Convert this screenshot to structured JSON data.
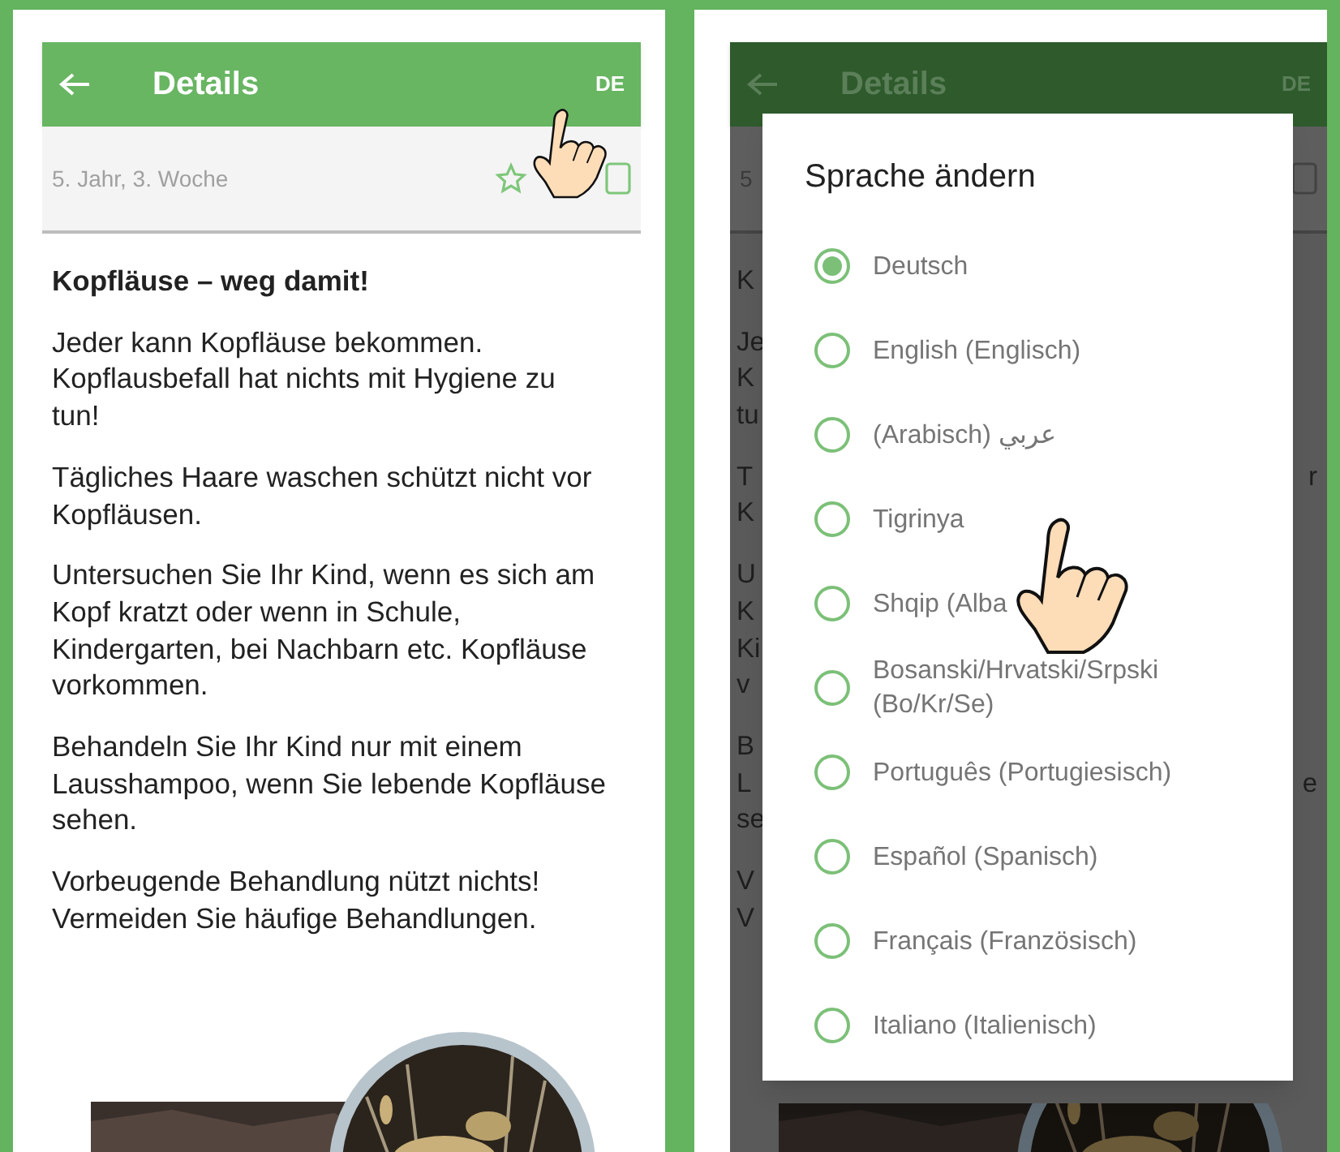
{
  "left_screen": {
    "app_bar": {
      "title": "Details",
      "language": "DE"
    },
    "subheader": {
      "text": "5. Jahr, 3. Woche"
    },
    "article": {
      "title": "Kopfläuse – weg damit!",
      "paragraphs": [
        "Jeder kann Kopfläuse bekommen. Kopflausbefall hat nichts mit Hygiene zu tun!",
        "Tägliches Haare waschen schützt nicht vor Kopfläusen.",
        "Untersuchen Sie Ihr Kind, wenn es sich am Kopf kratzt oder wenn in Schule, Kindergarten, bei Nachbarn etc. Kopfläuse vorkommen.",
        "Behandeln Sie Ihr Kind nur mit einem Lausshampoo, wenn Sie lebende Kopfläuse sehen.",
        "Vorbeugende Behandlung nützt nichts! Vermeiden Sie häufige Behandlungen."
      ]
    }
  },
  "right_screen": {
    "app_bar": {
      "title": "Details",
      "language": "DE"
    },
    "subheader": {
      "text": "5"
    },
    "article_fragments": [
      [
        {
          "left": "K"
        }
      ],
      [
        {
          "left": "Je"
        },
        {
          "left": "K"
        },
        {
          "left": "tu"
        }
      ],
      [
        {
          "left": "T",
          "right": "r"
        },
        {
          "left": "K"
        }
      ],
      [
        {
          "left": "U"
        },
        {
          "left": "K"
        },
        {
          "left": "Ki"
        },
        {
          "left": "v"
        }
      ],
      [
        {
          "left": "B"
        },
        {
          "left": "L",
          "right": "e"
        },
        {
          "left": "se"
        }
      ],
      [
        {
          "left": "V"
        },
        {
          "left": "V"
        }
      ]
    ]
  },
  "dialog": {
    "title": "Sprache ändern",
    "options": [
      {
        "label": "Deutsch",
        "selected": true
      },
      {
        "label": "English (Englisch)",
        "selected": false
      },
      {
        "label": "(Arabisch) عربي",
        "selected": false
      },
      {
        "label": "Tigrinya",
        "selected": false
      },
      {
        "label": "Shqip (Alba",
        "selected": false
      },
      {
        "label": "Bosanski/Hrvatski/Srpski (Bo/Kr/Se)",
        "selected": false
      },
      {
        "label": "Português (Portugiesisch)",
        "selected": false
      },
      {
        "label": "Español (Spanisch)",
        "selected": false
      },
      {
        "label": "Français (Französisch)",
        "selected": false
      },
      {
        "label": "Italiano (Italienisch)",
        "selected": false
      }
    ]
  }
}
